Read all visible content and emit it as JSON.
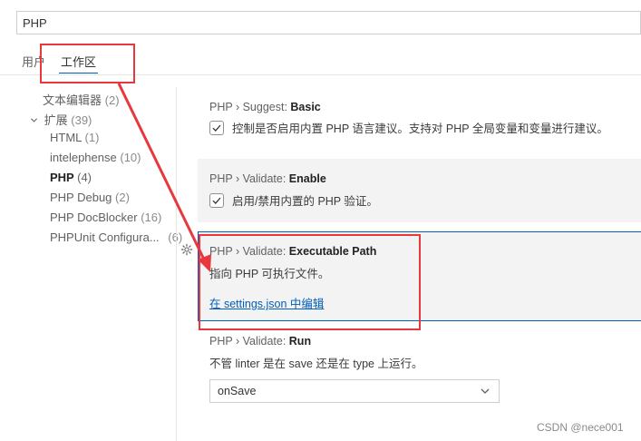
{
  "search": {
    "value": "PHP"
  },
  "tabs": [
    {
      "label": "用户"
    },
    {
      "label": "工作区"
    }
  ],
  "toc": [
    {
      "label": "文本编辑器",
      "count": "(2)"
    },
    {
      "label": "扩展",
      "count": "(39)",
      "expanded": true
    },
    {
      "label": "HTML",
      "count": "(1)"
    },
    {
      "label": "intelephense",
      "count": "(10)"
    },
    {
      "label": "PHP",
      "count": "(4)",
      "active": true
    },
    {
      "label": "PHP Debug",
      "count": "(2)"
    },
    {
      "label": "PHP DocBlocker",
      "count": "(16)"
    },
    {
      "label": "PHPUnit Configura...",
      "count": "(6)"
    }
  ],
  "settings": {
    "suggest": {
      "category": "PHP › Suggest: ",
      "key": "Basic",
      "description": "控制是否启用内置 PHP 语言建议。支持对 PHP 全局变量和变量进行建议。",
      "checked": true
    },
    "enable": {
      "category": "PHP › Validate: ",
      "key": "Enable",
      "description": "启用/禁用内置的 PHP 验证。",
      "checked": true
    },
    "path": {
      "category": "PHP › Validate: ",
      "key": "Executable Path",
      "description": "指向 PHP 可执行文件。",
      "link": "在 settings.json 中编辑"
    },
    "run": {
      "category": "PHP › Validate: ",
      "key": "Run",
      "description": "不管 linter 是在 save 还是在 type 上运行。",
      "selected": "onSave"
    }
  },
  "watermark": "CSDN @nece001",
  "colors": {
    "accent": "#005fb8",
    "annotation": "#e8383d"
  },
  "icons": [
    "check-icon",
    "gear-icon",
    "chevron-down-icon",
    "chevron-expanded-icon"
  ]
}
